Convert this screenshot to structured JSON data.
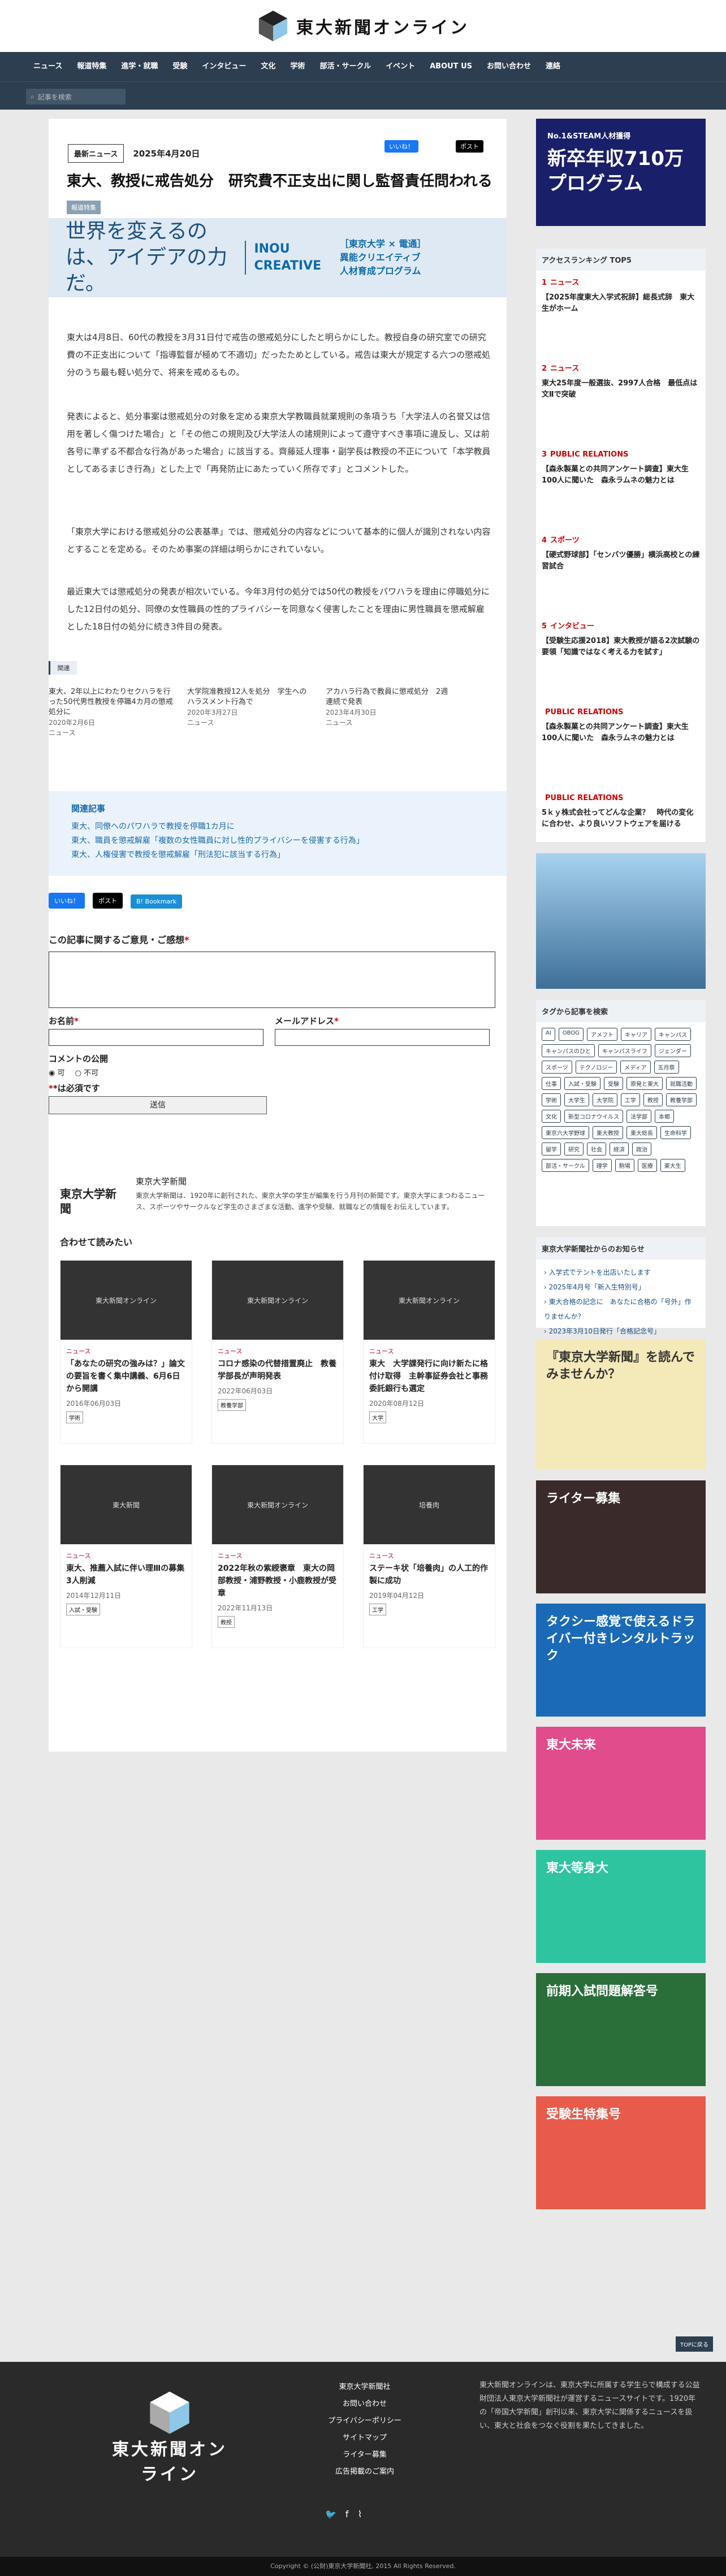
{
  "site": {
    "name": "東大新聞オンライン"
  },
  "nav": [
    "ニュース",
    "報道特集",
    "進学・就職",
    "受験",
    "インタビュー",
    "文化",
    "学術",
    "部活・サークル",
    "イベント",
    "ABOUT US",
    "お問い合わせ",
    "連絡"
  ],
  "search": {
    "placeholder": "記事を検索"
  },
  "article": {
    "badge": "最新ニュース",
    "date": "2025年4月20日",
    "share_fb": "いいね！",
    "share_x": "ポスト",
    "title": "東大、教授に戒告処分　研究費不正支出に関し監督責任問われる",
    "category": "報道特集",
    "banner_main": "世界を変えるのは、アイデアの力だ。",
    "banner_brand": "INOU CREATIVE",
    "banner_side": "［東京大学 × 電通］異能クリエイティブ人材育成プログラム",
    "p1": "東大は4月8日、60代の教授を3月31日付で戒告の懲戒処分にしたと明らかにした。教授自身の研究室での研究費の不正支出について「指導監督が極めて不適切」だったためとしている。戒告は東大が規定する六つの懲戒処分のうち最も軽い処分で、将来を戒めるもの。",
    "p2": "発表によると、処分事案は懲戒処分の対象を定める東京大学教職員就業規則の条項うち「大学法人の名誉又は信用を著しく傷つけた場合」と「その他この規則及び大学法人の諸規則によって遵守すべき事項に違反し、又は前各号に準ずる不都合な行為があった場合」に該当する。齊藤延人理事・副学長は教授の不正について「本学教員としてあるまじき行為」とした上で「再発防止にあたっていく所存です」とコメントした。",
    "p3": "「東京大学における懲戒処分の公表基準」では、懲戒処分の内容などについて基本的に個人が識別されない内容とすることを定める。そのため事案の詳細は明らかにされていない。",
    "p4": "最近東大では懲戒処分の発表が相次いでいる。今年3月付の処分では50代の教授をパワハラを理由に停職処分にした12日付の処分、同僚の女性職員の性的プライバシーを同意なく侵害したことを理由に男性職員を懲戒解雇とした18日付の処分に続き3件目の発表。"
  },
  "related": {
    "label": "関連",
    "items": [
      {
        "title": "東大、2年以上にわたりセクハラを行った50代男性教授を停職4カ月の懲戒処分に",
        "date": "2020年2月6日",
        "cat": "ニュース"
      },
      {
        "title": "大学院准教授12人を処分　学生へのハラスメント行為で",
        "date": "2020年3月27日",
        "cat": "ニュース"
      },
      {
        "title": "アカハラ行為で教員に懲戒処分　2週連続で発表",
        "date": "2023年4月30日",
        "cat": "ニュース"
      }
    ]
  },
  "kanren": {
    "title": "関連記事",
    "items": [
      "東大、同僚へのパワハラで教授を停職1カ月に",
      "東大、職員を懲戒解雇「複数の女性職員に対し性的プライバシーを侵害する行為」",
      "東大、人権侵害で教授を懲戒解雇「刑法犯に該当する行為」"
    ]
  },
  "buttons": {
    "fb": "いいね！",
    "x": "ポスト",
    "bm": "B! Bookmark"
  },
  "form": {
    "title": "この記事に関するご意見・ご感想",
    "name": "お名前",
    "email": "メールアドレス",
    "public": "コメントの公開",
    "yes": "可",
    "no": "不可",
    "req": "*は必須です",
    "submit": "送信"
  },
  "profile": {
    "name": "東京大学新聞",
    "desc": "東京大学新聞は、1920年に創刊された、東京大学の学生が編集を行う月刊の新聞です。東京大学にまつわるニュース、スポーツやサークルなど学生のさまざまな活動、進学や受験、就職などの情報をお伝えしています。",
    "logo": "東京大学新聞"
  },
  "more": {
    "title": "合わせて読みたい",
    "cards": [
      {
        "cat": "ニュース",
        "title": "「あなたの研究の強みは？」論文の要旨を書く集中講義、6月6日から開講",
        "date": "2016年06月03日",
        "tag": "学術",
        "thumb": "東大新聞オンライン"
      },
      {
        "cat": "ニュース",
        "title": "コロナ感染の代替措置廃止　教養学部長が声明発表",
        "date": "2022年06月03日",
        "tag": "教養学部",
        "thumb": "東大新聞オンライン"
      },
      {
        "cat": "ニュース",
        "title": "東大　大学課発行に向け新たに格付け取得　主幹事証券会社と事務委託銀行も選定",
        "date": "2020年08月12日",
        "tag": "大学",
        "thumb": "東大新聞オンライン"
      },
      {
        "cat": "ニュース",
        "title": "東大、推薦入試に伴い理Ⅲの募集3人削減",
        "date": "2014年12月11日",
        "tag": "入試・受験",
        "thumb": "東大新聞"
      },
      {
        "cat": "ニュース",
        "title": "2022年秋の紫綬褒章　東大の岡部教授・浦野教授・小鹿教授が受章",
        "date": "2022年11月13日",
        "tag": "教授",
        "thumb": "東大新聞オンライン"
      },
      {
        "cat": "ニュース",
        "title": "ステーキ状「培養肉」の人工的作製に成功",
        "date": "2019年04月12日",
        "tag": "工学",
        "thumb": "培養肉"
      }
    ]
  },
  "side": {
    "ranking_title": "アクセスランキング TOP5",
    "ranking": [
      {
        "n": "1",
        "cat": "ニュース",
        "title": "【2025年度東大入学式祝辞】総長式辞　東大生がホーム"
      },
      {
        "n": "2",
        "cat": "ニュース",
        "title": "東大25年度一般選抜、2997人合格　最低点は文Ⅱで突破"
      },
      {
        "n": "3",
        "cat": "PUBLIC RELATIONS",
        "title": "【森永製菓との共同アンケート調査】東大生100人に聞いた　森永ラムネの魅力とは"
      },
      {
        "n": "4",
        "cat": "スポーツ",
        "title": "【硬式野球部】「センバツ優勝」横浜高校との練習試合"
      },
      {
        "n": "5",
        "cat": "インタビュー",
        "title": "【受験生応援2018】東大教授が語る2次試験の要領「知識ではなく考える力を試す」"
      },
      {
        "n": "",
        "cat": "PUBLIC RELATIONS",
        "title": "【森永製菓との共同アンケート調査】東大生100人に聞いた　森永ラムネの魅力とは"
      },
      {
        "n": "",
        "cat": "PUBLIC RELATIONS",
        "title": "5ｋｙ株式会社ってどんな企業？　時代の変化に合わせ、より良いソフトウェアを届ける"
      }
    ],
    "ad1_top": "No.1&STEAM人材獲得",
    "ad1_main": "新卒年収710万プログラム",
    "tag_title": "タグから記事を検索",
    "tags": [
      "AI",
      "OBOG",
      "アメフト",
      "キャリア",
      "キャンパス",
      "キャンパスのひと",
      "キャンパスライフ",
      "ジェンダー",
      "スポーツ",
      "テクノロジー",
      "メディア",
      "五月祭",
      "仕事",
      "入試・受験",
      "受験",
      "原発と東大",
      "就職活動",
      "学術",
      "大学生",
      "大学院",
      "工学",
      "教授",
      "教養学部",
      "文化",
      "新型コロナウイルス",
      "法学部",
      "本郷",
      "東京六大学野球",
      "東大教授",
      "東大総長",
      "生命科学",
      "留学",
      "研究",
      "社会",
      "経済",
      "政治",
      "部活・サークル",
      "理学",
      "駒場",
      "医療",
      "東大生"
    ],
    "info_title": "東京大学新聞社からのお知らせ",
    "info": [
      "入学式でテントを出店いたします",
      "2025年4月号「新入生特別号」",
      "東大合格の記念に　あなたに合格の「号外」作りませんか？",
      "2023年3月10日発行「合格記念号」"
    ],
    "ad_side": [
      "『東京大学新聞』を読んでみませんか？",
      "ライター募集",
      "タクシー感覚で使えるドライバー付きレンタルトラック",
      "東大未来",
      "東大等身大",
      "前期入試問題解答号",
      "受験生特集号"
    ]
  },
  "footer": {
    "links": [
      "東京大学新聞社",
      "お問い合わせ",
      "プライバシーポリシー",
      "サイトマップ",
      "ライター募集",
      "広告掲載のご案内"
    ],
    "about": "東大新聞オンラインは、東京大学に所属する学生らで構成する公益財団法人東京大学新聞社が運営するニュースサイトです。1920年の「帝国大学新聞」創刊以来、東京大学に関係するニュースを扱い、東大と社会をつなぐ役割を果たしてきました。",
    "copy": "Copyright © (公財)東京大学新聞社, 2015 All Rights Reserved.",
    "top": "TOPに戻る"
  }
}
